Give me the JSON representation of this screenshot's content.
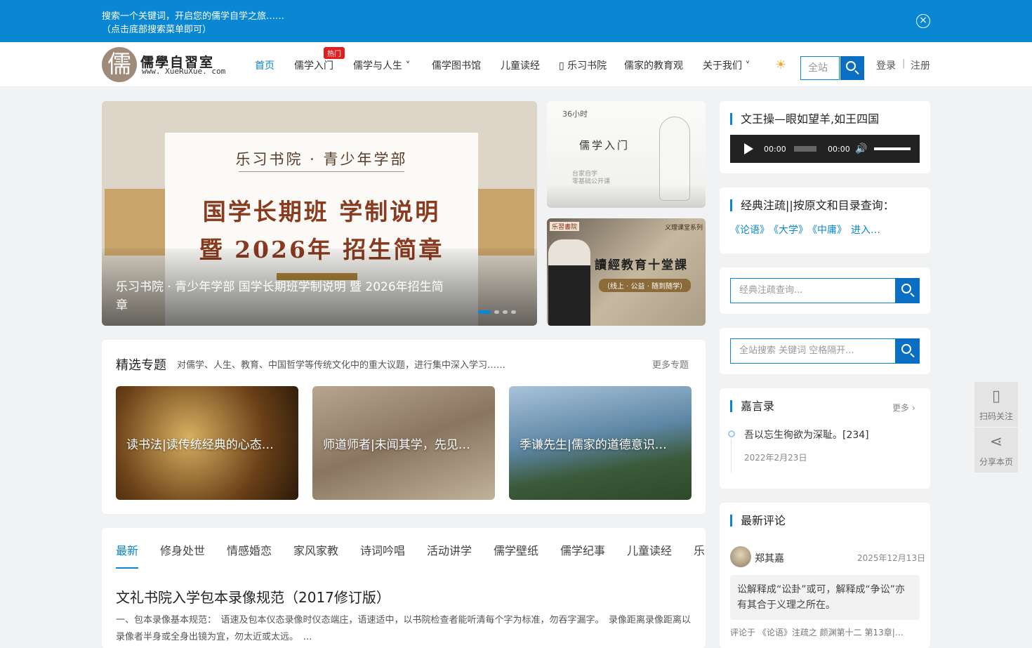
{
  "banner": {
    "line1": "搜索一个关键词，开启您的儒学自学之旅……",
    "line2": "（点击底部搜索菜单即可）",
    "close": "×"
  },
  "header": {
    "logo_glyph": "儒",
    "logo_title": "儒學自習室",
    "logo_url": "www. XueRuXue. com",
    "nav": [
      {
        "label": "首页",
        "active": true
      },
      {
        "label": "儒学入门",
        "badge": "热门"
      },
      {
        "label": "儒学与人生 ˅"
      },
      {
        "label": "儒学图书馆"
      },
      {
        "label": "儿童读经"
      },
      {
        "label": "▯ 乐习书院"
      },
      {
        "label": "儒家的教育观"
      },
      {
        "label": "关于我们 ˅"
      }
    ],
    "sun": "☀",
    "search_placeholder": "全站",
    "login": "登录",
    "sep": "|",
    "register": "注册"
  },
  "carousel": {
    "sub": "乐习书院 · 青少年学部",
    "big1": "国学长期班 学制说明",
    "big2": "暨 2026年 招生简章",
    "caption": "乐习书院 · 青少年学部 国学长期班学制说明 暨 2026年招生简章",
    "slides": 4,
    "active_slide": 1
  },
  "ad1": {
    "hours": "36小时",
    "title": "儒学入门",
    "line1": "台家自学",
    "line2": "零基础公开课"
  },
  "ad2": {
    "tag_left": "乐習書院",
    "tag_right": "义理课堂系列",
    "title": "讀經教育十堂課",
    "badge": "（线上 · 公益 · 随到随学）"
  },
  "audio": {
    "title": "文王操—眼如望羊,如王四国",
    "current": "00:00",
    "duration": "00:00",
    "volume_icon": "🔊"
  },
  "classics": {
    "title": "经典注疏||按原文和目录查询：",
    "links": [
      "《论语》",
      "《大学》",
      "《中庸》",
      "进入…"
    ]
  },
  "search1": {
    "placeholder": "经典注疏查询..."
  },
  "search2": {
    "placeholder": "全站搜索 关键词 空格隔开..."
  },
  "quotes": {
    "title": "嘉言录",
    "more": "更多 ›",
    "text": "吾以忘生徇欲为深耻。[234]",
    "date": "2022年2月23日"
  },
  "comments": {
    "title": "最新评论",
    "user": "郑其嘉",
    "date": "2025年12月13日",
    "body": "讼解释成“讼卦”或可，解释成“争讼”亦有其合于义理之所在。",
    "foot": "评论于 《论语》注疏之 颜渊第十二 第13章|…"
  },
  "tools": [
    {
      "icon": "▯",
      "label": "扫码关注"
    },
    {
      "icon": "⋖",
      "label": "分享本页"
    }
  ],
  "featured": {
    "title": "精选专题",
    "desc": "对儒学、人生、教育、中国哲学等传统文化中的重大议题，进行集中深入学习……",
    "more": "更多专题",
    "cards": [
      {
        "label": "读书法|读传统经典的心态…"
      },
      {
        "label": "师道师者|未闻其学，先见…"
      },
      {
        "label": "季谦先生|儒家的道德意识…"
      }
    ]
  },
  "articles": {
    "tabs": [
      "最新",
      "修身处世",
      "情感婚恋",
      "家风家教",
      "诗词吟唱",
      "活动讲学",
      "儒学壁纸",
      "儒学纪事",
      "儿童读经",
      "乐"
    ],
    "title": "文礼书院入学包本录像规范（2017修订版）",
    "excerpt": "一、包本录像基本规范：　语速及包本仪态录像时仪态端庄，语速适中，以书院检查者能听清每个字为标准，勿吞字漏字。　录像距离录像距离以录像者半身或全身出镜为宜，勿太近或太远。　…"
  }
}
